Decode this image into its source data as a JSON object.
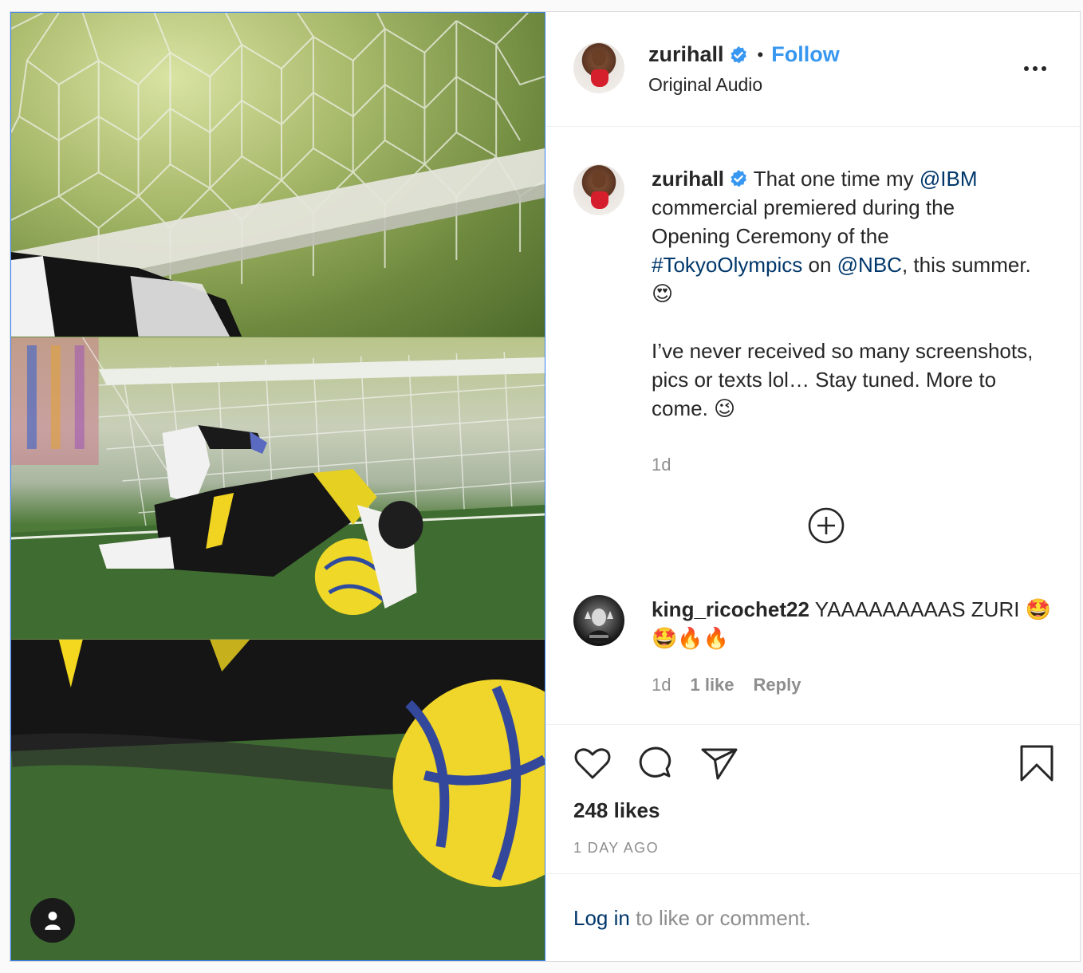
{
  "post": {
    "author": {
      "username": "zurihall",
      "verified": true,
      "follow_label": "Follow",
      "separator": "•",
      "audio": "Original Audio"
    },
    "caption": {
      "username": "zurihall",
      "text_1": "That one time my ",
      "mention_1": "@IBM",
      "text_2": " commercial premiered during the Opening Ceremony of the ",
      "hashtag_1": "#TokyoOlympics",
      "text_3": " on ",
      "mention_2": "@NBC",
      "text_4": ", this summer. ",
      "emoji_1": "😍",
      "paragraph_2": "I’ve never received so many screenshots, pics or texts lol… Stay tuned. More to come. ",
      "emoji_2": "😉",
      "time": "1d"
    },
    "comment": {
      "username": "king_ricochet22",
      "text": " YAAAAAAAAAS ZURI ",
      "emojis": "🤩🤩🔥🔥",
      "time": "1d",
      "likes": "1 like",
      "reply_label": "Reply"
    },
    "stats": {
      "likes": "248 likes",
      "posted": "1 DAY AGO"
    },
    "login_prompt": {
      "link": "Log in",
      "text": " to like or comment."
    },
    "icons": {
      "more": "more-options-icon",
      "plus": "load-more-comments-icon",
      "like": "heart-icon",
      "comment": "comment-bubble-icon",
      "share": "paper-plane-icon",
      "save": "bookmark-icon",
      "user": "user-tag-icon"
    },
    "colors": {
      "link_blue": "#00376b",
      "follow_blue": "#3797f0",
      "verified_blue": "#3897f0",
      "muted": "#8e8e8e"
    }
  }
}
